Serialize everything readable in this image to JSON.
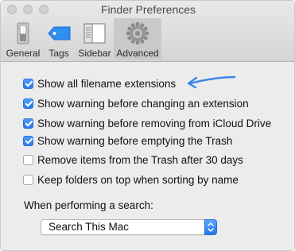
{
  "window": {
    "title": "Finder Preferences"
  },
  "toolbar": {
    "items": [
      {
        "label": "General",
        "icon": "general-switch-icon",
        "selected": false
      },
      {
        "label": "Tags",
        "icon": "tag-icon",
        "selected": false
      },
      {
        "label": "Sidebar",
        "icon": "sidebar-icon",
        "selected": false
      },
      {
        "label": "Advanced",
        "icon": "gear-icon",
        "selected": true
      }
    ]
  },
  "options": [
    {
      "label": "Show all filename extensions",
      "checked": true
    },
    {
      "label": "Show warning before changing an extension",
      "checked": true
    },
    {
      "label": "Show warning before removing from iCloud Drive",
      "checked": true
    },
    {
      "label": "Show warning before emptying the Trash",
      "checked": true
    },
    {
      "label": "Remove items from the Trash after 30 days",
      "checked": false
    },
    {
      "label": "Keep folders on top when sorting by name",
      "checked": false
    }
  ],
  "search": {
    "label": "When performing a search:",
    "selected_value": "Search This Mac"
  },
  "colors": {
    "accent": "#2a78ef",
    "annotation_arrow": "#3f86e6"
  }
}
